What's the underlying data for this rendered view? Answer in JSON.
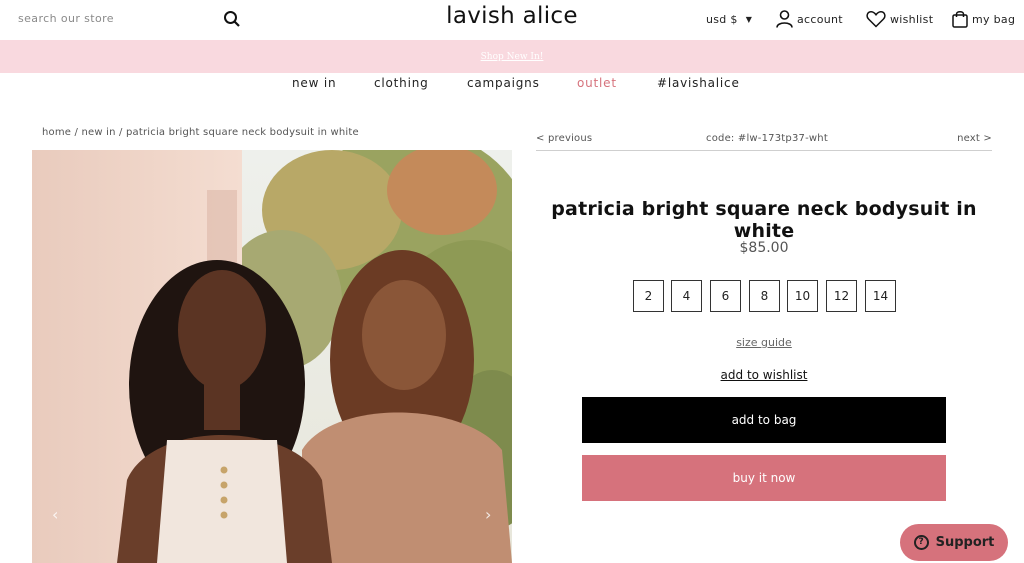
{
  "header": {
    "search_placeholder": "search our store",
    "logo": "lavish alice",
    "currency": "usd $",
    "account": "account",
    "wishlist": "wishlist",
    "bag": "my bag"
  },
  "banner": {
    "link": "Shop New In!"
  },
  "nav": {
    "items": [
      "new in",
      "clothing",
      "campaigns",
      "outlet",
      "#lavishalice"
    ]
  },
  "breadcrumb": "home / new in / patricia bright square neck bodysuit in white",
  "product_nav": {
    "previous": "< previous",
    "code": "code: #lw-173tp37-wht",
    "next": "next >"
  },
  "product": {
    "title": "patricia bright square neck bodysuit in white",
    "price": "$85.00",
    "sizes": [
      "2",
      "4",
      "6",
      "8",
      "10",
      "12",
      "14"
    ],
    "size_guide": "size guide",
    "add_to_wishlist": "add to wishlist",
    "add_to_bag": "add to bag",
    "buy_now": "buy it now"
  },
  "gallery": {
    "prev_arrow": "‹",
    "next_arrow": "›"
  },
  "support": {
    "label": "Support",
    "icon_glyph": "?"
  },
  "colors": {
    "accent": "#d6727c",
    "banner": "#f9d9df",
    "primary_button": "#000000"
  }
}
